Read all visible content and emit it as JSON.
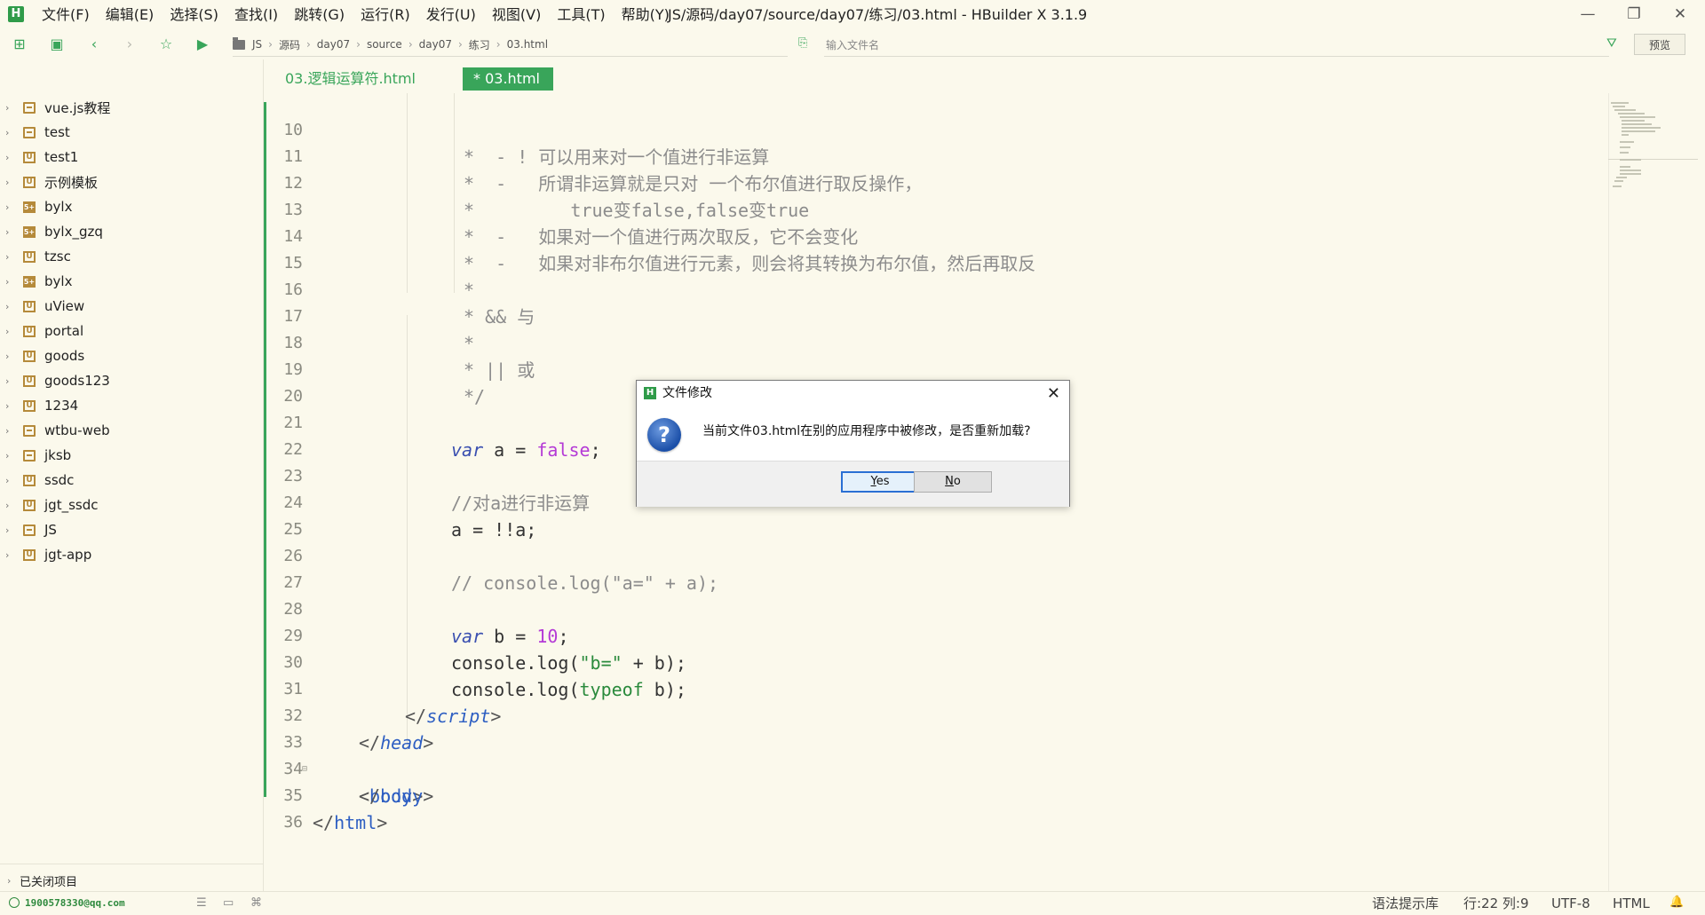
{
  "app": {
    "logo": "H",
    "window_title": "JS/源码/day07/source/day07/练习/03.html - HBuilder X 3.1.9"
  },
  "menu": [
    "文件(F)",
    "编辑(E)",
    "选择(S)",
    "查找(I)",
    "跳转(G)",
    "运行(R)",
    "发行(U)",
    "视图(V)",
    "工具(T)",
    "帮助(Y)"
  ],
  "window_controls": {
    "minimize": "—",
    "restore": "❐",
    "close": "✕"
  },
  "toolbar": {
    "breadcrumb": [
      "JS",
      "源码",
      "day07",
      "source",
      "day07",
      "练习",
      "03.html"
    ],
    "file_search_placeholder": "输入文件名",
    "preview_label": "预览"
  },
  "sidebar": {
    "projects": [
      {
        "label": "vue.js教程",
        "icon": "folder"
      },
      {
        "label": "test",
        "icon": "folder"
      },
      {
        "label": "test1",
        "icon": "uni-app"
      },
      {
        "label": "示例模板",
        "icon": "uni-app"
      },
      {
        "label": "bylx",
        "icon": "5plus-app"
      },
      {
        "label": "bylx_gzq",
        "icon": "5plus-app"
      },
      {
        "label": "tzsc",
        "icon": "uni-app"
      },
      {
        "label": "bylx",
        "icon": "5plus-app"
      },
      {
        "label": "uView",
        "icon": "uni-app"
      },
      {
        "label": "portal",
        "icon": "uni-app"
      },
      {
        "label": "goods",
        "icon": "uni-app"
      },
      {
        "label": "goods123",
        "icon": "uni-app"
      },
      {
        "label": "1234",
        "icon": "uni-app"
      },
      {
        "label": "wtbu-web",
        "icon": "folder"
      },
      {
        "label": "jksb",
        "icon": "folder"
      },
      {
        "label": "ssdc",
        "icon": "uni-app"
      },
      {
        "label": "jgt_ssdc",
        "icon": "uni-app"
      },
      {
        "label": "JS",
        "icon": "folder"
      },
      {
        "label": "jgt-app",
        "icon": "uni-app"
      }
    ],
    "closed_projects": "已关闭项目"
  },
  "tabs": [
    {
      "label": "03.逻辑运算符.html",
      "active": false
    },
    {
      "label": "* 03.html",
      "active": true
    }
  ],
  "editor": {
    "line_numbers": [
      "10",
      "11",
      "12",
      "13",
      "14",
      "15",
      "16",
      "17",
      "18",
      "19",
      "20",
      "21",
      "22",
      "23",
      "24",
      "25",
      "26",
      "27",
      "28",
      "29",
      "30",
      "31",
      "32",
      "33",
      "34",
      "35",
      "36"
    ],
    "lines": {
      "l10": "*  - ! 可以用来对一个值进行非运算",
      "l11": "*  -   所谓非运算就是只对 一个布尔值进行取反操作，",
      "l12": "*         true变false,false变true",
      "l13": "*  -   如果对一个值进行两次取反，它不会变化",
      "l14": "*  -   如果对非布尔值进行元素，则会将其转换为布尔值，然后再取反",
      "l15": "*",
      "l16": "* && 与",
      "l17": "*",
      "l18": "* || 或",
      "l19": "*/",
      "l21_kw": "var",
      "l21_mid": " a = ",
      "l21_val": "false",
      "l21_end": ";",
      "l23": "//对a进行非运算",
      "l24": "a = !!a;",
      "l26": "// console.log(\"a=\" + a);",
      "l28_kw": "var",
      "l28_mid": " b = ",
      "l28_val": "10",
      "l28_end": ";",
      "l29_fn": "console.log(",
      "l29_str": "\"b=\"",
      "l29_end": " + b);",
      "l30_fn": "console.log(",
      "l30_kw": "typeof",
      "l30_end": " b);",
      "l31_open": "</",
      "l31_tag": "script",
      "l31_close": ">",
      "l32_open": "</",
      "l32_tag": "head",
      "l32_close": ">",
      "l33_open": "<",
      "l33_tag": "body",
      "l33_close": ">",
      "l34_open": "</",
      "l34_tag": "body",
      "l34_close": ">",
      "l35_open": "</",
      "l35_tag": "html",
      "l35_close": ">"
    }
  },
  "dialog": {
    "title": "文件修改",
    "message": "当前文件03.html在别的应用程序中被修改，是否重新加载?",
    "yes_first": "Y",
    "yes_rest": "es",
    "no_first": "N",
    "no_rest": "o"
  },
  "statusbar": {
    "user": "1900578330@qq.com",
    "syntax_lib": "语法提示库",
    "cursor": "行:22  列:9",
    "encoding": "UTF-8",
    "language": "HTML"
  },
  "colors": {
    "accent": "#39a55a",
    "background": "#fbf9ec",
    "keyword": "#3a4fb0",
    "literal": "#b43ad6",
    "tag": "#2d5ec2",
    "comment": "#8c8c8c"
  }
}
